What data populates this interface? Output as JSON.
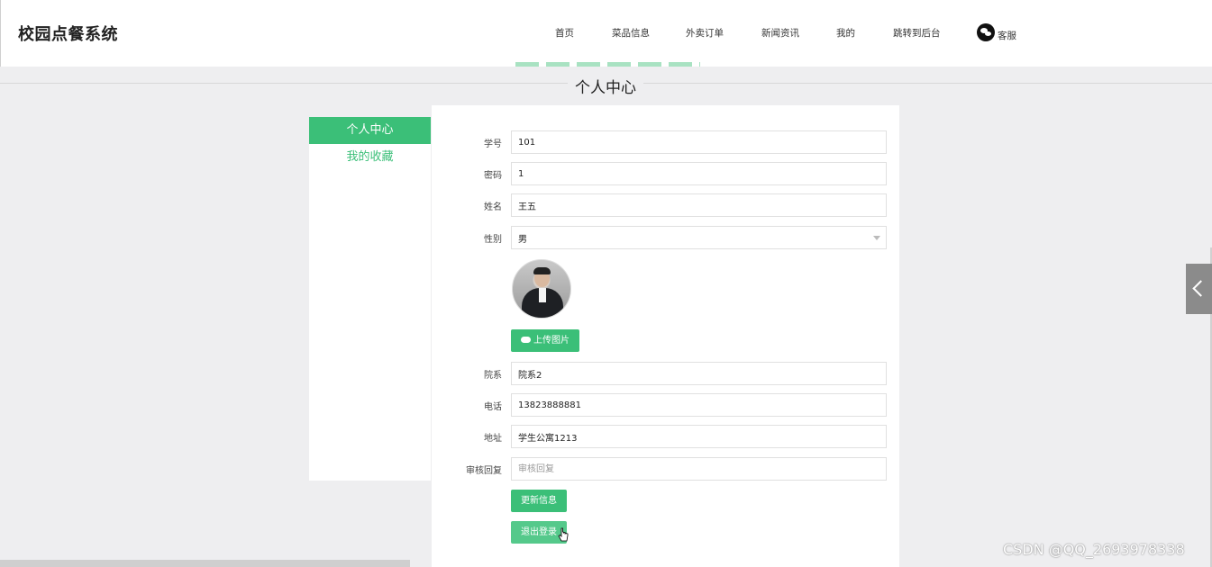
{
  "header": {
    "logo": "校园点餐系统",
    "nav": [
      "首页",
      "菜品信息",
      "外卖订单",
      "新闻资讯",
      "我的",
      "跳转到后台"
    ],
    "service": "客服"
  },
  "section_title": "个人中心",
  "sidebar": {
    "items": [
      {
        "label": "个人中心",
        "active": true
      },
      {
        "label": "我的收藏",
        "active": false
      }
    ]
  },
  "form": {
    "student_id": {
      "label": "学号",
      "value": "101"
    },
    "password": {
      "label": "密码",
      "value": "1"
    },
    "name": {
      "label": "姓名",
      "value": "王五"
    },
    "gender": {
      "label": "性别",
      "value": "男"
    },
    "upload_label": "上传图片",
    "department": {
      "label": "院系",
      "value": "院系2"
    },
    "phone": {
      "label": "电话",
      "value": "13823888881"
    },
    "address": {
      "label": "地址",
      "value": "学生公寓1213"
    },
    "review_reply": {
      "label": "审核回复",
      "value": "",
      "placeholder": "审核回复"
    },
    "update_label": "更新信息",
    "logout_label": "退出登录"
  },
  "watermark": "CSDN @QQ_2693978338",
  "colors": {
    "accent": "#3bbf78",
    "background": "#eeeef0"
  }
}
